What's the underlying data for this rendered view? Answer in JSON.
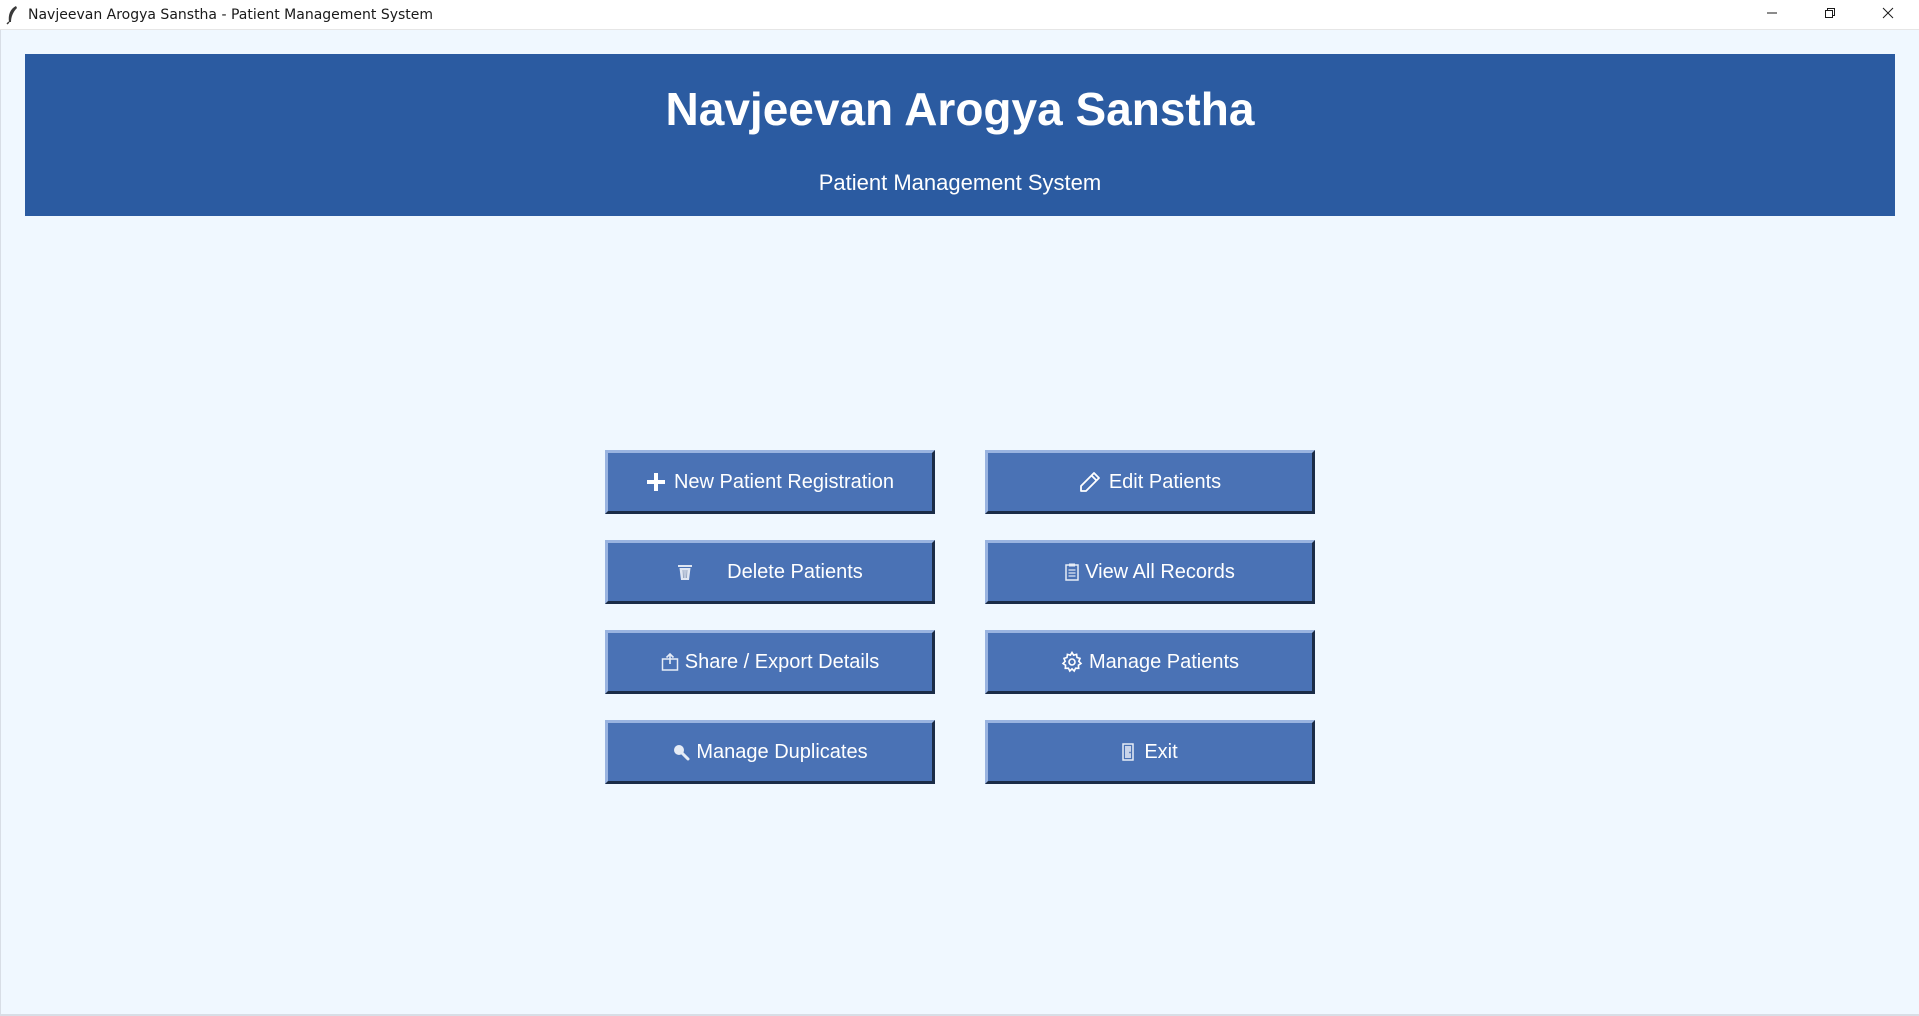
{
  "window": {
    "title": "Navjeevan Arogya Sanstha - Patient Management System",
    "controls": [
      "minimize-icon",
      "restore-icon",
      "close-icon"
    ]
  },
  "header": {
    "title": "Navjeevan Arogya Sanstha",
    "subtitle": "Patient Management System"
  },
  "buttons": [
    {
      "label": "New Patient Registration",
      "icon": "plus-icon"
    },
    {
      "label": "Edit Patients",
      "icon": "pencil-icon"
    },
    {
      "label": "Delete Patients",
      "icon": "trash-icon"
    },
    {
      "label": "View All Records",
      "icon": "clipboard-icon"
    },
    {
      "label": "Share / Export Details",
      "icon": "export-icon"
    },
    {
      "label": "Manage Patients",
      "icon": "gear-icon"
    },
    {
      "label": "Manage Duplicates",
      "icon": "magnifier-icon"
    },
    {
      "label": "Exit",
      "icon": "door-icon"
    }
  ],
  "colors": {
    "background": "#f0f8ff",
    "header": "#2b5ba1",
    "button": "#4a72b5",
    "text_light": "#ffffff"
  }
}
